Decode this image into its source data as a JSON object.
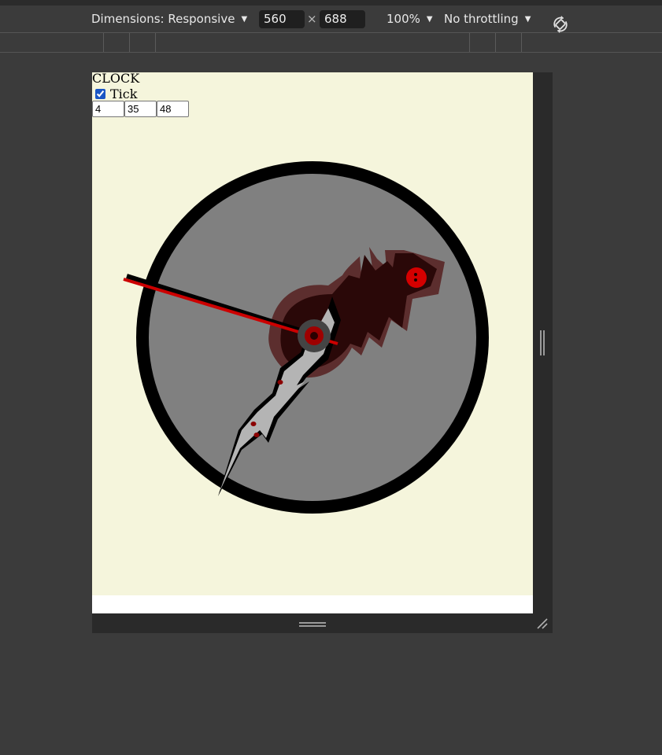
{
  "devtools": {
    "dimensions_label": "Dimensions: Responsive",
    "width": "560",
    "height": "688",
    "times": "×",
    "zoom": "100%",
    "throttling": "No throttling",
    "icons": [
      "chevron-down-icon",
      "rotate-icon",
      "resize-handle-icon"
    ]
  },
  "page": {
    "title": "CLOCK",
    "tick_label": "Tick",
    "tick_checked": true,
    "hours": "4",
    "minutes": "35",
    "seconds": "48",
    "background": "#f5f5dc"
  },
  "colors": {
    "clock_face": "#808080",
    "clock_rim": "#000000",
    "second_hand": "#cc0000",
    "hand_dark": "#2a0808",
    "hand_shadow": "#5c2e2e",
    "hand_light": "#b4b4b4"
  }
}
